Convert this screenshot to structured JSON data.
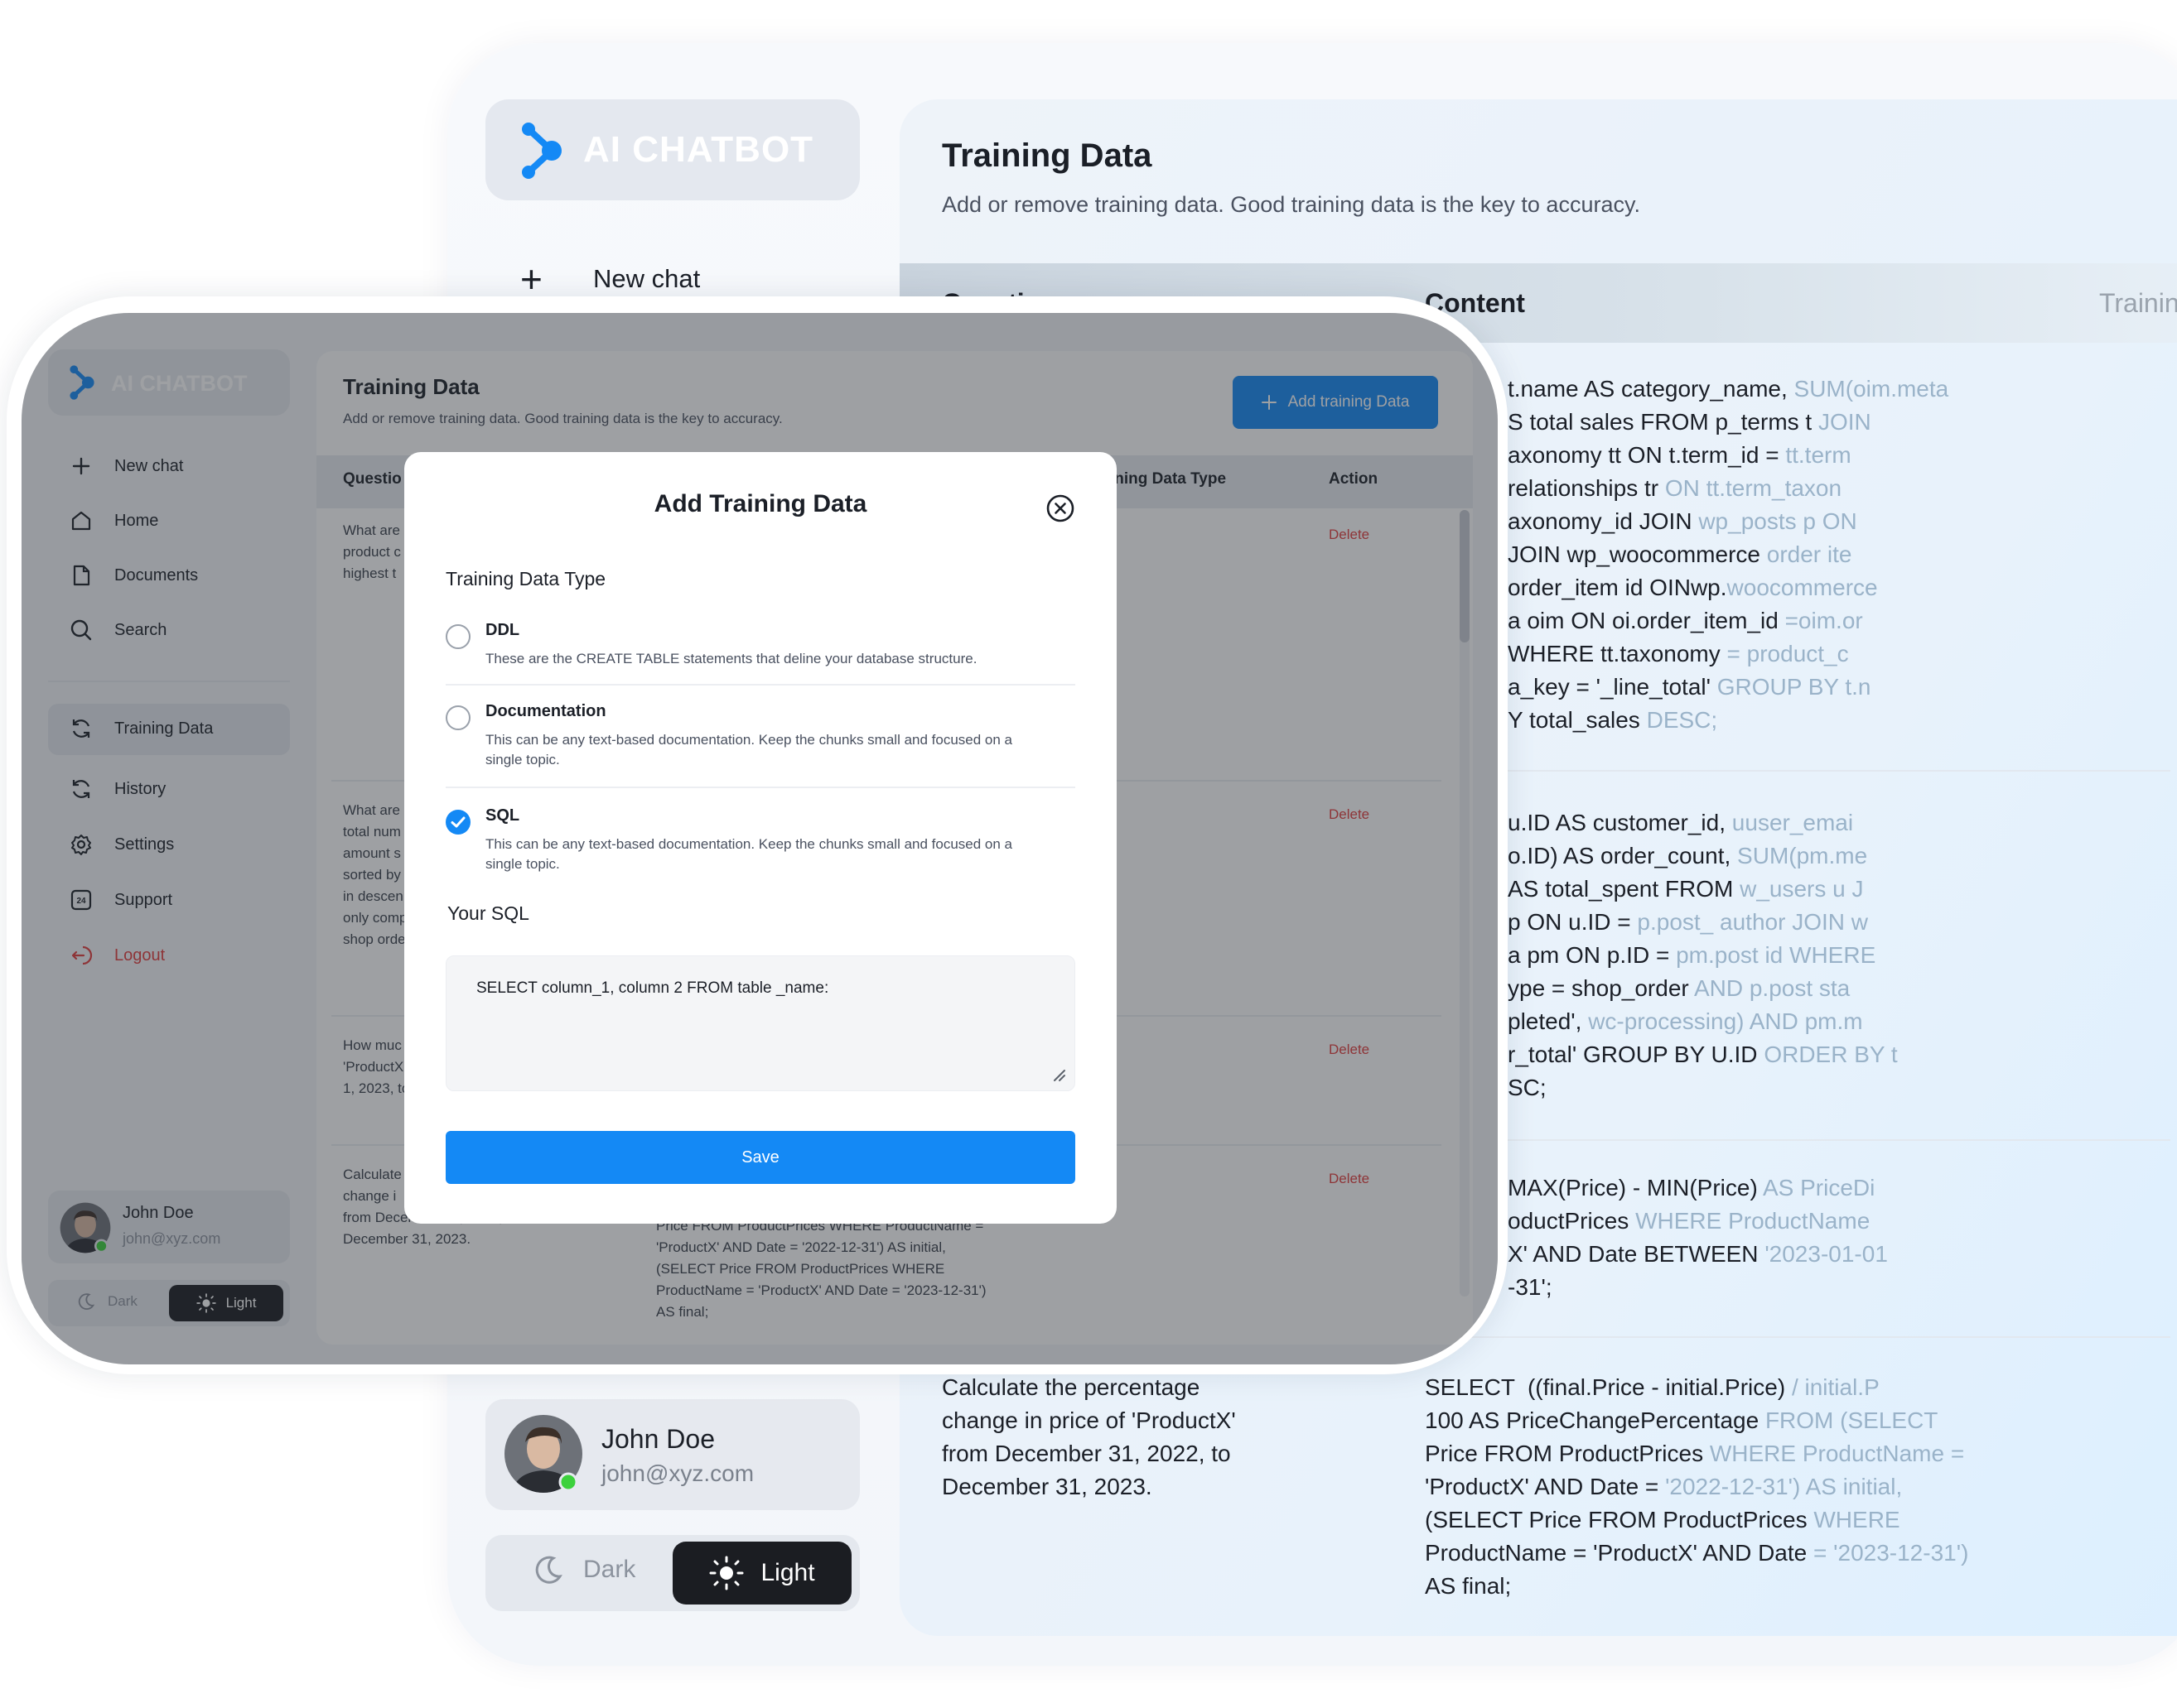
{
  "app": {
    "logo_text": "AI CHATBOT",
    "accent_color": "#1489f5"
  },
  "back": {
    "new_chat_label": "New chat",
    "page_title": "Training Data",
    "page_subtitle": "Add or remove training data. Good training data is the key to accuracy.",
    "table_headers": {
      "question": "Question",
      "content": "Content",
      "type": "Trainin"
    },
    "code_block_1": [
      {
        "a": "t.name AS category_name, ",
        "b": "SUM(oim.meta"
      },
      {
        "a": "S total sales FROM p_terms t ",
        "b": "JOIN"
      },
      {
        "a": "axonomy tt ON t.term_id = ",
        "b": "tt.term"
      },
      {
        "a": "relationships tr ",
        "b": "ON tt.term_taxon"
      },
      {
        "a": "axonomy_id JOIN ",
        "b": "wp_posts p ON"
      },
      {
        "a": "JOIN wp_woocommerce ",
        "b": "order ite"
      },
      {
        "a": "order_item id OINwp.",
        "b": "woocommerce"
      },
      {
        "a": "a oim ON oi.order_item_id ",
        "b": "=oim.or"
      },
      {
        "a": "WHERE tt.taxonomy ",
        "b": "= product_c"
      },
      {
        "a": "a_key = '_line_total' ",
        "b": "GROUP BY t.n"
      },
      {
        "a": "Y total_sales ",
        "b": "DESC;"
      }
    ],
    "code_block_2": [
      {
        "a": "u.ID AS customer_id, ",
        "b": "uuser_emai"
      },
      {
        "a": "o.ID) AS order_count, ",
        "b": "SUM(pm.me"
      },
      {
        "a": "AS total_spent FROM ",
        "b": "w_users u J"
      },
      {
        "a": "p ON u.ID = ",
        "b": "p.post_ author JOIN w"
      },
      {
        "a": "a pm ON p.ID = ",
        "b": "pm.post id WHERE"
      },
      {
        "a": "ype = shop_order ",
        "b": "AND p.post sta"
      },
      {
        "a": "pleted', ",
        "b": "wc-processing) AND pm.m"
      },
      {
        "a": "r_total' GROUP BY U.ID ",
        "b": "ORDER BY t"
      },
      {
        "a": "SC;",
        "b": ""
      }
    ],
    "code_block_3": [
      {
        "a": "MAX(Price) - MIN(Price) ",
        "b": "AS PriceDi"
      },
      {
        "a": "oductPrices ",
        "b": "WHERE ProductName"
      },
      {
        "a": "X' AND Date BETWEEN ",
        "b": "'2023-01-01"
      },
      {
        "a": "-31';",
        "b": ""
      }
    ],
    "last_question": "Calculate the percentage change in price of 'ProductX' from December 31, 2022, to December 31, 2023.",
    "code_block_4": [
      {
        "a": "SELECT  ((final.Price - initial.Price) ",
        "b": "/ initial.P"
      },
      {
        "a": "100 AS PriceChangePercentage ",
        "b": "FROM (SELECT"
      },
      {
        "a": "Price FROM ProductPrices ",
        "b": "WHERE ProductName ="
      },
      {
        "a": "'ProductX' AND Date = ",
        "b": "'2022-12-31') AS initial,"
      },
      {
        "a": "(SELECT Price FROM ProductPrices ",
        "b": "WHERE"
      },
      {
        "a": "ProductName = 'ProductX' AND Date ",
        "b": "= '2023-12-31')"
      },
      {
        "a": "AS final;",
        "b": ""
      }
    ],
    "user": {
      "name": "John Doe",
      "email": "john@xyz.com"
    },
    "theme": {
      "dark": "Dark",
      "light": "Light"
    }
  },
  "front": {
    "sidebar": {
      "items": [
        {
          "label": "New chat",
          "icon": "plus-icon"
        },
        {
          "label": "Home",
          "icon": "home-icon"
        },
        {
          "label": "Documents",
          "icon": "document-icon"
        },
        {
          "label": "Search",
          "icon": "search-icon"
        },
        {
          "label": "Training Data",
          "icon": "refresh-icon"
        },
        {
          "label": "History",
          "icon": "history-icon"
        },
        {
          "label": "Settings",
          "icon": "gear-icon"
        },
        {
          "label": "Support",
          "icon": "support-24-icon"
        },
        {
          "label": "Logout",
          "icon": "logout-icon"
        }
      ]
    },
    "page_title": "Training Data",
    "page_subtitle": "Add or remove training data. Good training data is the key to accuracy.",
    "add_button": "Add training Data",
    "table_headers": {
      "question": "Questio",
      "type": "ining Data Type",
      "action": "Action"
    },
    "rows": [
      {
        "question": [
          "What are",
          "product c",
          "highest t"
        ],
        "action": "Delete"
      },
      {
        "question": [
          "What are",
          "total num",
          "amount s",
          "sorted by",
          "in descen",
          "only comp",
          "shop orde"
        ],
        "action": "Delete"
      },
      {
        "question": [
          "How muc",
          "'ProductX",
          "1, 2023, to"
        ],
        "action": "Delete"
      },
      {
        "question": [
          "Calculate",
          "change i",
          "from December 31, 2022, to",
          "December 31, 2023."
        ],
        "action": "Delete"
      }
    ],
    "row4_content": [
      "Price FROM ProductPrices WHERE ProductName =",
      "'ProductX' AND Date = '2022-12-31') AS initial,",
      "(SELECT Price FROM ProductPrices WHERE",
      "ProductName = 'ProductX' AND Date = '2023-12-31')",
      "AS final;"
    ],
    "user": {
      "name": "John Doe",
      "email": "john@xyz.com"
    },
    "theme": {
      "dark": "Dark",
      "light": "Light"
    }
  },
  "modal": {
    "title": "Add Training Data",
    "type_label": "Training Data Type",
    "options": [
      {
        "title": "DDL",
        "desc": "These are the CREATE TABLE statements that deline your database structure.",
        "checked": false
      },
      {
        "title": "Documentation",
        "desc": "This can be any text-based documentation. Keep the chunks small and focused on a single topic.",
        "checked": false
      },
      {
        "title": "SQL",
        "desc": "This can be any text-based documentation. Keep the chunks small and focused on a single topic.",
        "checked": true
      }
    ],
    "sql_label": "Your SQL",
    "sql_value": "SELECT column_1, column 2 FROM table _name:",
    "save_label": "Save"
  }
}
